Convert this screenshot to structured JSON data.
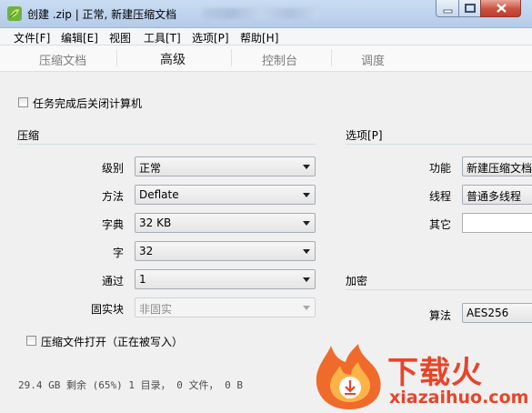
{
  "window": {
    "title": "创建 .zip | 正常, 新建压缩文档"
  },
  "menu": [
    "文件[F]",
    "编辑[E]",
    "视图",
    "工具[T]",
    "选项[P]",
    "帮助[H]"
  ],
  "tabs": [
    {
      "label": "压缩文档",
      "active": false
    },
    {
      "label": "高级",
      "active": true
    },
    {
      "label": "控制台",
      "active": false
    },
    {
      "label": "调度",
      "active": false
    }
  ],
  "shutdown_checkbox": {
    "label": "任务完成后关闭计算机",
    "checked": false
  },
  "compression": {
    "title": "压缩",
    "level": {
      "label": "级别",
      "value": "正常"
    },
    "method": {
      "label": "方法",
      "value": "Deflate"
    },
    "dictionary": {
      "label": "字典",
      "value": "32 KB"
    },
    "word": {
      "label": "字",
      "value": "32"
    },
    "passes": {
      "label": "通过",
      "value": "1"
    },
    "solid": {
      "label": "固实块",
      "value": "非固实"
    }
  },
  "open_archive_checkbox": {
    "label": "压缩文件打开（正在被写入）",
    "checked": false
  },
  "options": {
    "title": "选项[P]",
    "function": {
      "label": "功能",
      "value": "新建压缩文档"
    },
    "threads": {
      "label": "线程",
      "value": "普通多线程"
    },
    "other": {
      "label": "其它",
      "value": ""
    }
  },
  "encryption": {
    "title": "加密",
    "algorithm": {
      "label": "算法",
      "value": "AES256"
    }
  },
  "status": "29.4 GB 剩余 (65%)  1 目录， 0 文件， 0 B",
  "watermark": {
    "text": "下载火",
    "url": "xiazaihuo.com"
  },
  "colors": {
    "accent_red": "#e8442a",
    "titlebar": "#c9dcf2"
  }
}
